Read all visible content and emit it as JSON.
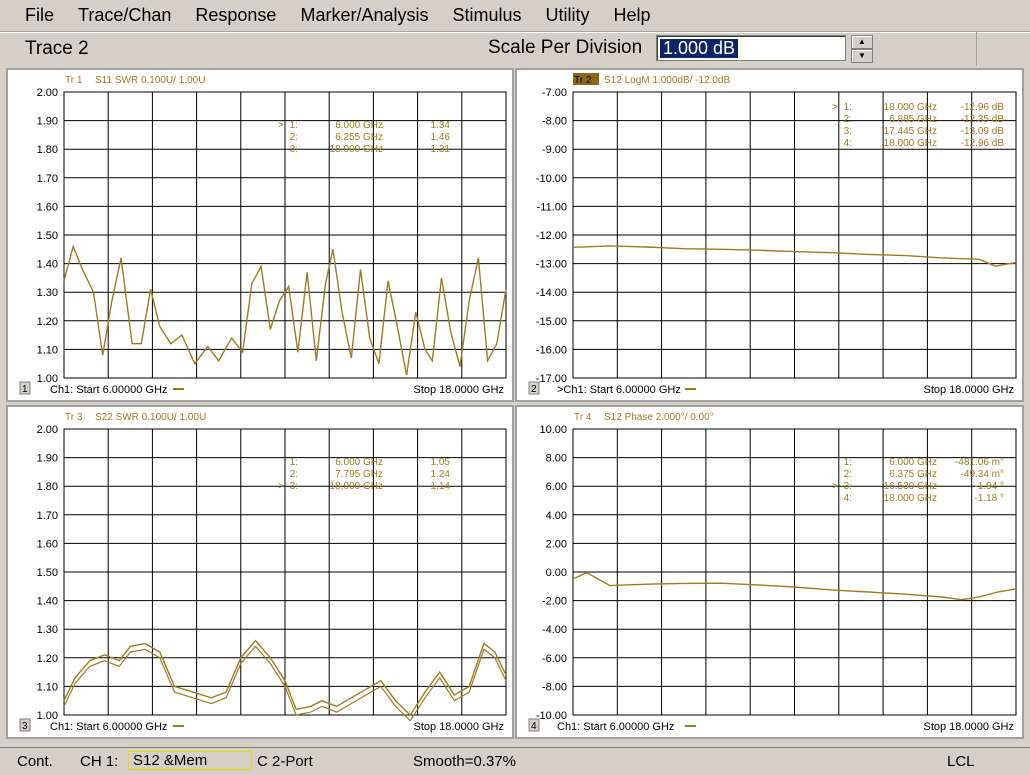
{
  "menu": [
    "File",
    "Trace/Chan",
    "Response",
    "Marker/Analysis",
    "Stimulus",
    "Utility",
    "Help"
  ],
  "toolbar": {
    "trace_label": "Trace 2",
    "scale_label": "Scale Per Division",
    "scale_value": "1.000 dB"
  },
  "colors": {
    "trace": "#c8a030",
    "grid": "#e6e6e6",
    "label": "#a07c20",
    "panel_bg": "#ffffff",
    "tb_active": "#8b6914"
  },
  "panels": [
    {
      "num": "1",
      "title_prefix": "Tr  1",
      "title": "S11 SWR 0.100U/  1.00U",
      "yticks": [
        "2.00",
        "1.90",
        "1.80",
        "1.70",
        "1.60",
        "1.50",
        "1.40",
        "1.30",
        "1.20",
        "1.10",
        "1.00"
      ],
      "start": "Ch1: Start  6.00000 GHz",
      "stop": "Stop  18.0000 GHz",
      "markers": [
        {
          "sel": ">",
          "id": "1:",
          "freq": "6.000 GHz",
          "val": "1.34"
        },
        {
          "sel": "",
          "id": "2:",
          "freq": "6.255 GHz",
          "val": "1.46"
        },
        {
          "sel": "",
          "id": "3:",
          "freq": "18.000 GHz",
          "val": "1.31"
        }
      ]
    },
    {
      "num": "2",
      "title_prefix": "Tr  2",
      "title": "S12 LogM 1.000dB/  -12.0dB",
      "yticks": [
        "-7.00",
        "-8.00",
        "-9.00",
        "-10.00",
        "-11.00",
        "-12.00",
        "-13.00",
        "-14.00",
        "-15.00",
        "-16.00",
        "-17.00"
      ],
      "start": ">Ch1: Start  6.00000 GHz",
      "stop": "Stop  18.0000 GHz",
      "markers": [
        {
          "sel": ">",
          "id": "1:",
          "freq": "18.000 GHz",
          "val": "-12.96 dB"
        },
        {
          "sel": "",
          "id": "2:",
          "freq": "6.885 GHz",
          "val": "-12.35 dB"
        },
        {
          "sel": "",
          "id": "3:",
          "freq": "17.445 GHz",
          "val": "-13.09 dB"
        },
        {
          "sel": "",
          "id": "4:",
          "freq": "18.000 GHz",
          "val": "-12.96 dB"
        }
      ]
    },
    {
      "num": "3",
      "title_prefix": "Tr  3",
      "title": "S22 SWR 0.100U/  1.00U",
      "yticks": [
        "2.00",
        "1.90",
        "1.80",
        "1.70",
        "1.60",
        "1.50",
        "1.40",
        "1.30",
        "1.20",
        "1.10",
        "1.00"
      ],
      "start": "Ch1: Start  6.00000 GHz",
      "stop": "Stop  18.0000 GHz",
      "markers": [
        {
          "sel": "",
          "id": "1:",
          "freq": "6.000 GHz",
          "val": "1.05"
        },
        {
          "sel": "",
          "id": "2:",
          "freq": "7.795 GHz",
          "val": "1.24"
        },
        {
          "sel": ">",
          "id": "3:",
          "freq": "18.000 GHz",
          "val": "1.14"
        }
      ]
    },
    {
      "num": "4",
      "title_prefix": "Tr  4",
      "title": "S12 Phase 2.000°/  0.00°",
      "yticks": [
        "10.00",
        "8.00",
        "6.00",
        "4.00",
        "2.00",
        "0.00",
        "-2.00",
        "-4.00",
        "-6.00",
        "-8.00",
        "-10.00"
      ],
      "start": "Ch1: Start  6.00000 GHz",
      "stop": "Stop  18.0000 GHz",
      "markers": [
        {
          "sel": "",
          "id": "1:",
          "freq": "6.000 GHz",
          "val": "-481.06 m°"
        },
        {
          "sel": "",
          "id": "2:",
          "freq": "6.375 GHz",
          "val": "-49.34 m°"
        },
        {
          "sel": ">",
          "id": "3:",
          "freq": "16.530 GHz",
          "val": "-1.94 °"
        },
        {
          "sel": "",
          "id": "4:",
          "freq": "18.000 GHz",
          "val": "-1.18 °"
        }
      ]
    }
  ],
  "traces": [
    {
      "x": [
        6.0,
        6.25,
        6.5,
        6.8,
        7.05,
        7.3,
        7.55,
        7.85,
        8.1,
        8.35,
        8.6,
        8.9,
        9.2,
        9.55,
        9.9,
        10.2,
        10.55,
        10.85,
        11.1,
        11.35,
        11.6,
        11.85,
        12.1,
        12.35,
        12.6,
        12.85,
        13.1,
        13.3,
        13.55,
        13.8,
        14.05,
        14.3,
        14.55,
        14.8,
        15.05,
        15.3,
        15.55,
        15.8,
        16.0,
        16.25,
        16.5,
        16.75,
        17.0,
        17.25,
        17.5,
        17.75,
        18.0
      ],
      "y": [
        1.34,
        1.46,
        1.38,
        1.3,
        1.08,
        1.27,
        1.42,
        1.12,
        1.12,
        1.31,
        1.18,
        1.12,
        1.15,
        1.05,
        1.11,
        1.06,
        1.14,
        1.09,
        1.33,
        1.39,
        1.17,
        1.27,
        1.32,
        1.09,
        1.37,
        1.06,
        1.33,
        1.45,
        1.23,
        1.07,
        1.38,
        1.14,
        1.05,
        1.34,
        1.18,
        1.01,
        1.23,
        1.1,
        1.06,
        1.35,
        1.16,
        1.04,
        1.27,
        1.42,
        1.06,
        1.12,
        1.31
      ]
    },
    {
      "x": [
        6.0,
        7.0,
        8.0,
        9.0,
        10.0,
        11.0,
        12.0,
        13.0,
        14.0,
        15.0,
        16.0,
        17.0,
        17.45,
        18.0
      ],
      "y": [
        -12.43,
        -12.38,
        -12.42,
        -12.48,
        -12.5,
        -12.53,
        -12.58,
        -12.62,
        -12.68,
        -12.72,
        -12.8,
        -12.85,
        -13.09,
        -12.96
      ]
    },
    {
      "x": [
        6.0,
        6.3,
        6.7,
        7.1,
        7.5,
        7.8,
        8.2,
        8.6,
        9.0,
        9.5,
        10.0,
        10.4,
        10.8,
        11.2,
        11.6,
        12.0,
        12.3,
        12.7,
        13.0,
        13.4,
        13.8,
        14.2,
        14.6,
        15.0,
        15.4,
        15.8,
        16.2,
        16.6,
        17.0,
        17.4,
        17.7,
        18.0
      ],
      "y": [
        1.05,
        1.13,
        1.19,
        1.21,
        1.19,
        1.24,
        1.25,
        1.22,
        1.1,
        1.08,
        1.06,
        1.08,
        1.2,
        1.26,
        1.2,
        1.12,
        1.02,
        1.03,
        1.05,
        1.03,
        1.06,
        1.09,
        1.12,
        1.05,
        1.0,
        1.08,
        1.15,
        1.07,
        1.1,
        1.25,
        1.22,
        1.14
      ]
    },
    {
      "x": [
        6.0,
        6.375,
        7.0,
        8.0,
        9.0,
        10.0,
        11.0,
        12.0,
        13.0,
        14.0,
        15.0,
        16.0,
        16.53,
        17.0,
        17.5,
        18.0
      ],
      "y": [
        -0.48,
        -0.05,
        -0.95,
        -0.85,
        -0.8,
        -0.78,
        -0.9,
        -1.05,
        -1.25,
        -1.4,
        -1.55,
        -1.75,
        -1.94,
        -1.75,
        -1.4,
        -1.18
      ]
    }
  ],
  "status": {
    "mode": "Cont.",
    "channel": "CH 1:",
    "active": "S12 &Mem",
    "cal": "C  2-Port",
    "smooth": "Smooth=0.37%",
    "remote": "LCL"
  }
}
